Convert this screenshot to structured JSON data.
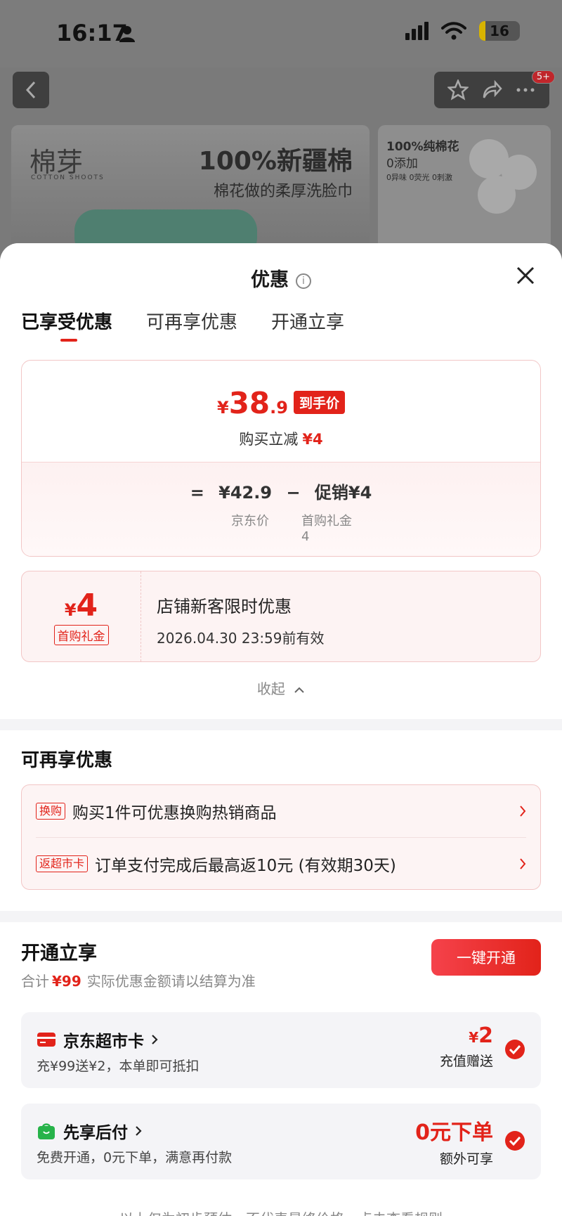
{
  "status_bar": {
    "time": "16:17",
    "battery": "16"
  },
  "nav": {
    "badge": "5+"
  },
  "banner": {
    "logo_cn": "棉芽",
    "logo_en": "COTTON SHOOTS",
    "title": "100%新疆棉",
    "subtitle": "棉花做的柔厚洗脸巾",
    "side_title": "100%纯棉花",
    "side_sub": "0添加",
    "side_small": "0异味 0荧光 0刺激"
  },
  "sheet": {
    "title": "优惠",
    "tabs": [
      {
        "label": "已享受优惠",
        "active": true
      },
      {
        "label": "可再享优惠",
        "active": false
      },
      {
        "label": "开通立享",
        "active": false
      }
    ],
    "price_card": {
      "final_yen": "¥",
      "final_int": "38",
      "final_dec": ".9",
      "final_tag": "到手价",
      "instant_label": "购买立减",
      "instant_value": "¥4",
      "eq": "=",
      "base_price": "¥42.9",
      "minus": "−",
      "promo": "促销¥4",
      "base_label": "京东价",
      "promo_label": "首购礼金",
      "promo_label_value": "4"
    },
    "coupon": {
      "yen": "¥",
      "amount": "4",
      "type": "首购礼金",
      "title": "店铺新客限时优惠",
      "valid": "2026.04.30 23:59前有效"
    },
    "collapse_label": "收起",
    "more_section": {
      "title": "可再享优惠",
      "items": [
        {
          "badge": "换购",
          "text": "购买1件可优惠换购热销商品"
        },
        {
          "badge": "返超市卡",
          "text": "订单支付完成后最高返10元 (有效期30天)"
        }
      ]
    },
    "open_section": {
      "title": "开通立享",
      "sub_prefix": "合计",
      "sub_amount": "¥99",
      "sub_suffix": "实际优惠金额请以结算为准",
      "button": "一键开通",
      "benefits": [
        {
          "icon": "card-icon",
          "name": "京东超市卡",
          "desc": "充¥99送¥2，本单即可抵扣",
          "value_yen": "¥",
          "value": "2",
          "value_note": "充值赠送"
        },
        {
          "icon": "bag-icon",
          "name": "先享后付",
          "desc": "免费开通，0元下单，满意再付款",
          "value_yen": "",
          "value": "0元下单",
          "value_note": "额外可享"
        }
      ]
    },
    "footer": "以上仅为初步预估，不代表最终价格，点击查看规则"
  },
  "colors": {
    "accent": "#e2231a",
    "green": "#27b34a"
  }
}
